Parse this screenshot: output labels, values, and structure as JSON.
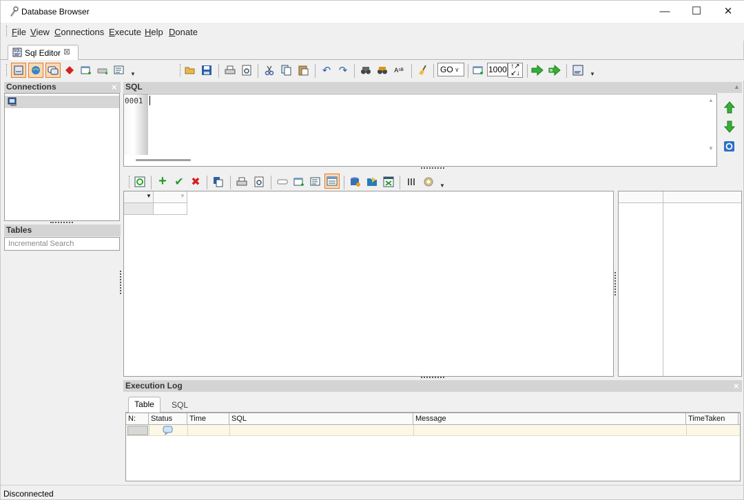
{
  "window": {
    "title": "Database Browser",
    "controls": {
      "minimize": "—",
      "maximize": "☐",
      "close": "✕"
    }
  },
  "menu": [
    {
      "accel": "F",
      "rest": "ile"
    },
    {
      "accel": "V",
      "rest": "iew"
    },
    {
      "accel": "C",
      "rest": "onnections"
    },
    {
      "accel": "E",
      "rest": "xecute"
    },
    {
      "accel": "H",
      "rest": "elp"
    },
    {
      "accel": "D",
      "rest": "onate"
    }
  ],
  "tabs": [
    {
      "label": "Sql Editor",
      "close": "⊠"
    }
  ],
  "toolbar": {
    "go_label": "GO",
    "max_rows": "1000"
  },
  "connections": {
    "title": "Connections",
    "close": "×"
  },
  "tables": {
    "title": "Tables",
    "search_placeholder": "Incremental Search"
  },
  "sql": {
    "title": "SQL",
    "line_number": "0001"
  },
  "execution_log": {
    "title": "Execution Log",
    "close": "×",
    "tabs": [
      "Table",
      "SQL"
    ],
    "columns": [
      "N:",
      "Status",
      "Time",
      "SQL",
      "Message",
      "TimeTaken"
    ]
  },
  "status_bar": {
    "text": "Disconnected"
  },
  "colors": {
    "accent_border": "#e07b2c",
    "accent_fill": "#f8d9b3",
    "panel_header": "#d4d4d4",
    "log_row": "#fdf8e6",
    "arrow_green": "#2ea02e"
  }
}
